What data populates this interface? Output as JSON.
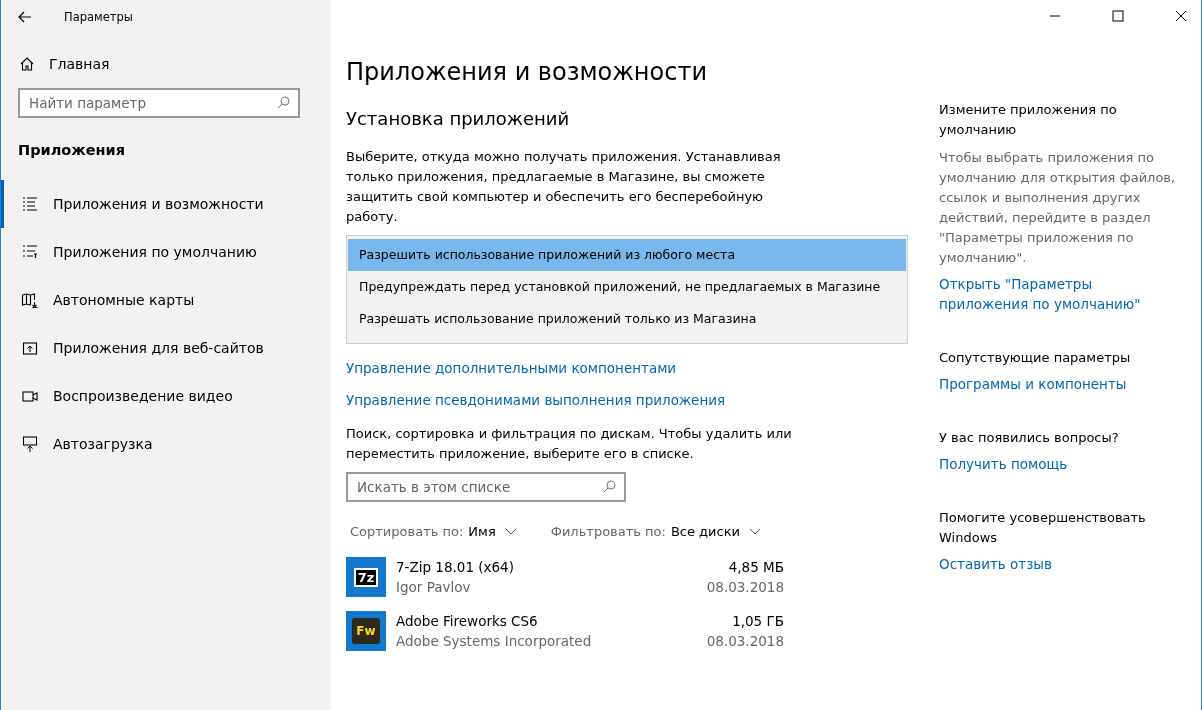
{
  "window": {
    "title": "Параметры"
  },
  "sidebar": {
    "home": "Главная",
    "search": {
      "placeholder": "Найти параметр"
    },
    "section": "Приложения",
    "items": [
      {
        "label": "Приложения и возможности",
        "selected": true,
        "kind": "list"
      },
      {
        "label": "Приложения по умолчанию",
        "selected": false,
        "kind": "default"
      },
      {
        "label": "Автономные карты",
        "selected": false,
        "kind": "map"
      },
      {
        "label": "Приложения для веб-сайтов",
        "selected": false,
        "kind": "web"
      },
      {
        "label": "Воспроизведение видео",
        "selected": false,
        "kind": "video"
      },
      {
        "label": "Автозагрузка",
        "selected": false,
        "kind": "startup"
      }
    ]
  },
  "main": {
    "title": "Приложения и возможности",
    "section_title": "Установка приложений",
    "description": "Выберите, откуда можно получать приложения. Устанавливая только приложения, предлагаемые в Магазине, вы сможете защитить свой компьютер и обеспечить его бесперебойную работу.",
    "install_options": [
      {
        "label": "Разрешить использование приложений из любого места",
        "selected": true
      },
      {
        "label": "Предупреждать перед установкой приложений, не предлагаемых в Магазине",
        "selected": false
      },
      {
        "label": "Разрешать использование приложений только из Магазина",
        "selected": false
      }
    ],
    "links": [
      "Управление дополнительными компонентами",
      "Управление псевдонимами выполнения приложения"
    ],
    "list_description": "Поиск, сортировка и фильтрация по дискам. Чтобы удалить или переместить приложение, выберите его в списке.",
    "list_search": {
      "placeholder": "Искать в этом списке"
    },
    "sort": {
      "label": "Сортировать по:",
      "value": "Имя"
    },
    "filter": {
      "label": "Фильтровать по:",
      "value": "Все диски"
    },
    "apps": [
      {
        "name": "7-Zip 18.01 (x64)",
        "publisher": "Igor Pavlov",
        "size": "4,85 МБ",
        "date": "08.03.2018",
        "icon_label": "7z",
        "kind": "zip"
      },
      {
        "name": "Adobe Fireworks CS6",
        "publisher": "Adobe Systems Incorporated",
        "size": "1,05 ГБ",
        "date": "08.03.2018",
        "icon_label": "Fw",
        "kind": "fireworks"
      }
    ]
  },
  "aside": [
    {
      "heading": "Измените приложения по умолчанию",
      "text": "Чтобы выбрать приложения по умолчанию для открытия файлов, ссылок и выполнения других действий, перейдите в раздел \"Параметры приложения по умолчанию\".",
      "link": "Открыть \"Параметры приложения по умолчанию\""
    },
    {
      "heading": "Сопутствующие параметры",
      "link": "Программы и компоненты"
    },
    {
      "heading": "У вас появились вопросы?",
      "link": "Получить помощь"
    },
    {
      "heading": "Помогите усовершенствовать Windows",
      "link": "Оставить отзыв"
    }
  ]
}
